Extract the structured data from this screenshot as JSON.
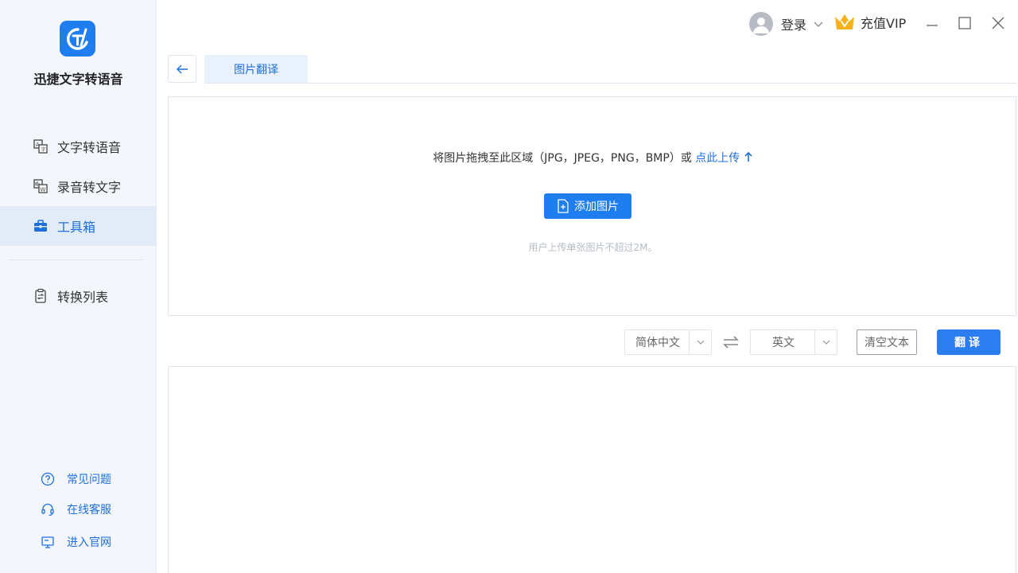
{
  "sidebar": {
    "app_name": "迅捷文字转语音",
    "nav": [
      {
        "label": "文字转语音",
        "icon": "text-to-speech-icon"
      },
      {
        "label": "录音转文字",
        "icon": "audio-to-text-icon"
      },
      {
        "label": "工具箱",
        "icon": "toolbox-icon",
        "active": true
      },
      {
        "label": "转换列表",
        "icon": "conversion-list-icon"
      }
    ],
    "bottom_links": [
      {
        "label": "常见问题",
        "icon": "question-icon"
      },
      {
        "label": "在线客服",
        "icon": "headset-icon"
      },
      {
        "label": "进入官网",
        "icon": "monitor-icon"
      }
    ]
  },
  "topbar": {
    "login_label": "登录",
    "vip_label": "充值VIP"
  },
  "tabs": [
    {
      "label": "图片翻译",
      "active": true
    }
  ],
  "upload": {
    "hint": "将图片拖拽至此区域（JPG，JPEG，PNG，BMP）或",
    "hint_link": "点此上传",
    "button_label": "添加图片",
    "note": "用户上传单张图片不超过2M。"
  },
  "controls": {
    "source_language": "简体中文",
    "target_language": "英文",
    "clear_label": "清空文本",
    "translate_label": "翻译"
  },
  "colors": {
    "accent": "#1e7ef0",
    "sidebar_bg": "#f3f7fc",
    "active_bg": "#e2ecf8"
  }
}
